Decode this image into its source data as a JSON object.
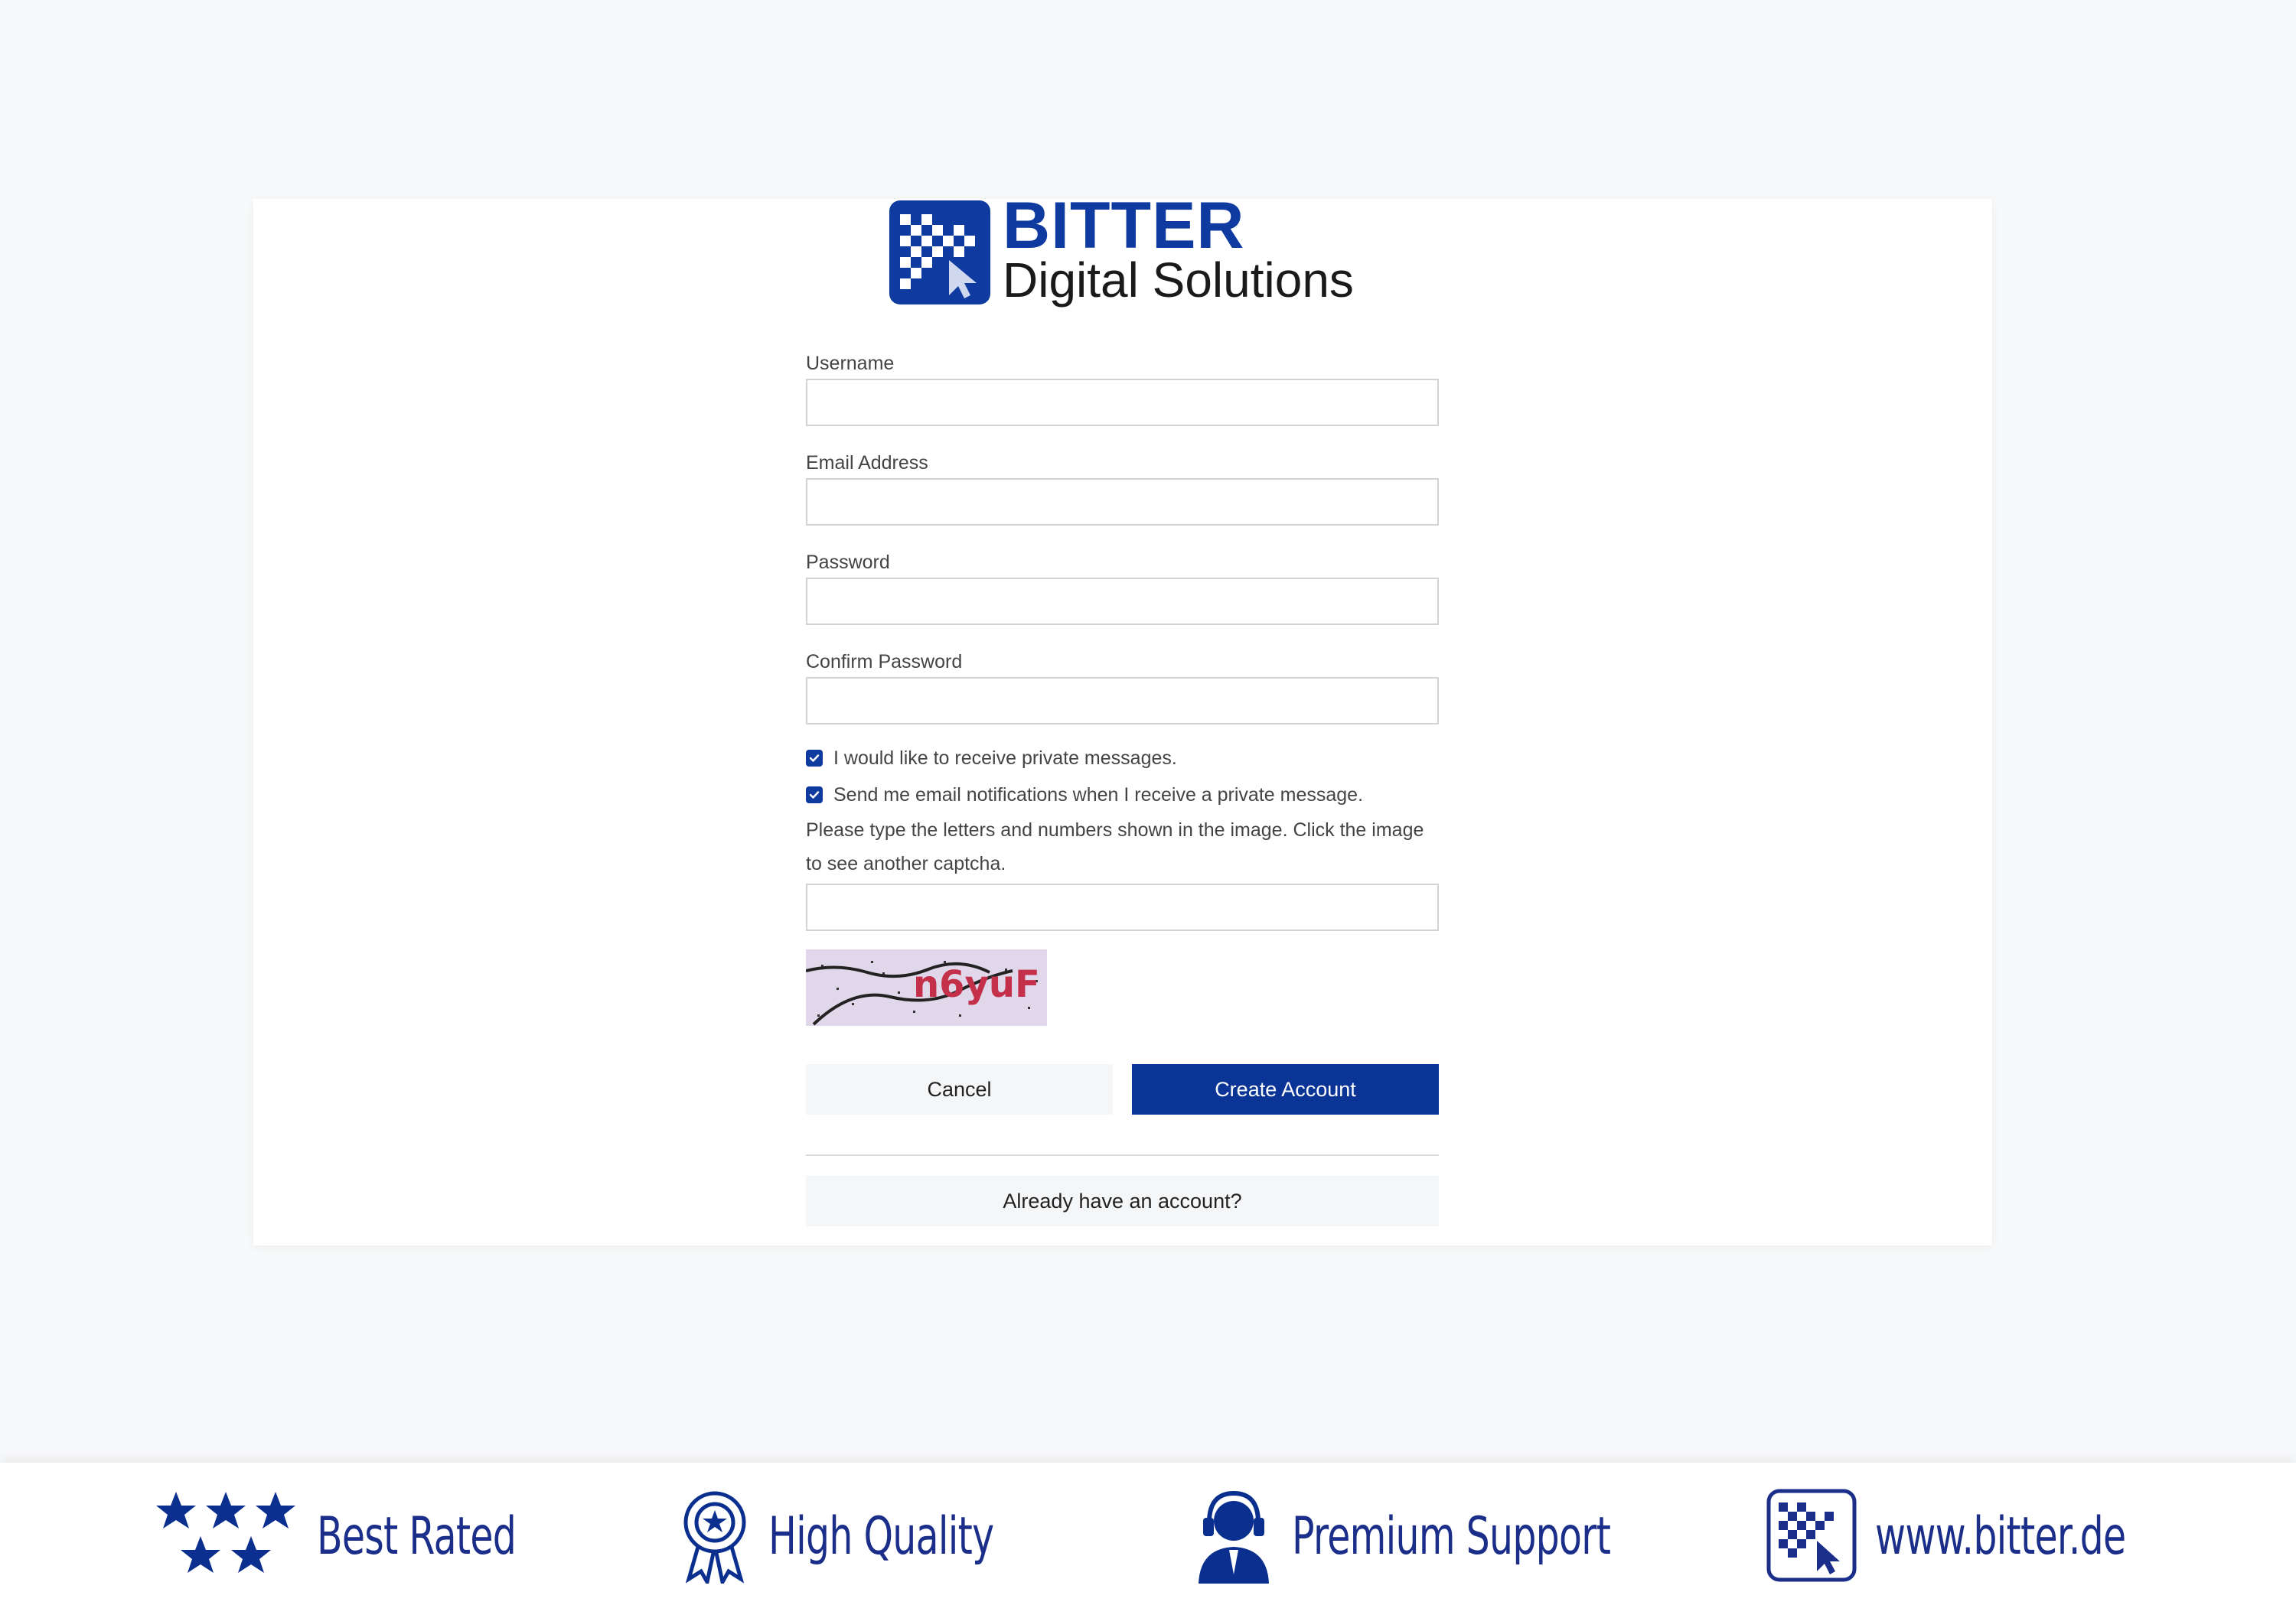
{
  "brand": {
    "name": "BITTER",
    "tagline": "Digital Solutions"
  },
  "form": {
    "username_label": "Username",
    "email_label": "Email Address",
    "password_label": "Password",
    "confirm_label": "Confirm Password",
    "username_value": "",
    "email_value": "",
    "password_value": "",
    "confirm_value": "",
    "checkbox_private_messages": {
      "label": "I would like to receive private messages.",
      "checked": true
    },
    "checkbox_email_notifications": {
      "label": "Send me email notifications when I receive a private message.",
      "checked": true
    },
    "captcha_help": "Please type the letters and numbers shown in the image. Click the image to see another captcha.",
    "captcha_value": "",
    "captcha_text": "n6yuF",
    "cancel_label": "Cancel",
    "create_label": "Create Account",
    "login_label": "Already have an account?"
  },
  "footer": {
    "items": [
      {
        "label": "Best Rated",
        "icon": "stars-icon"
      },
      {
        "label": "High Quality",
        "icon": "award-ribbon-icon"
      },
      {
        "label": "Premium Support",
        "icon": "support-agent-icon"
      },
      {
        "label": "www.bitter.de",
        "icon": "bitter-logo-icon"
      }
    ]
  },
  "colors": {
    "brand_blue": "#0f3aa0",
    "button_blue": "#0a3597",
    "footer_blue": "#1a2e8a"
  }
}
